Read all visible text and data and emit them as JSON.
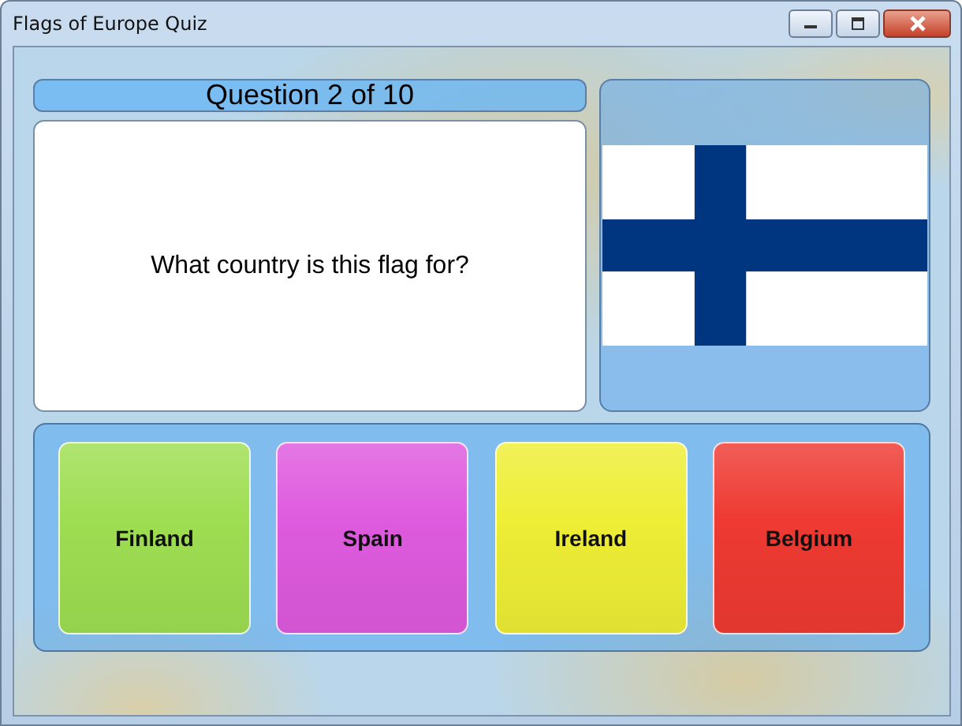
{
  "window": {
    "title": "Flags of Europe Quiz"
  },
  "question": {
    "counter": "Question 2 of 10",
    "text": "What country is this flag for?"
  },
  "answers": [
    {
      "label": "Finland",
      "color": "#9ede52"
    },
    {
      "label": "Spain",
      "color": "#de5ade"
    },
    {
      "label": "Ireland",
      "color": "#eeee36"
    },
    {
      "label": "Belgium",
      "color": "#ee3a32"
    }
  ]
}
